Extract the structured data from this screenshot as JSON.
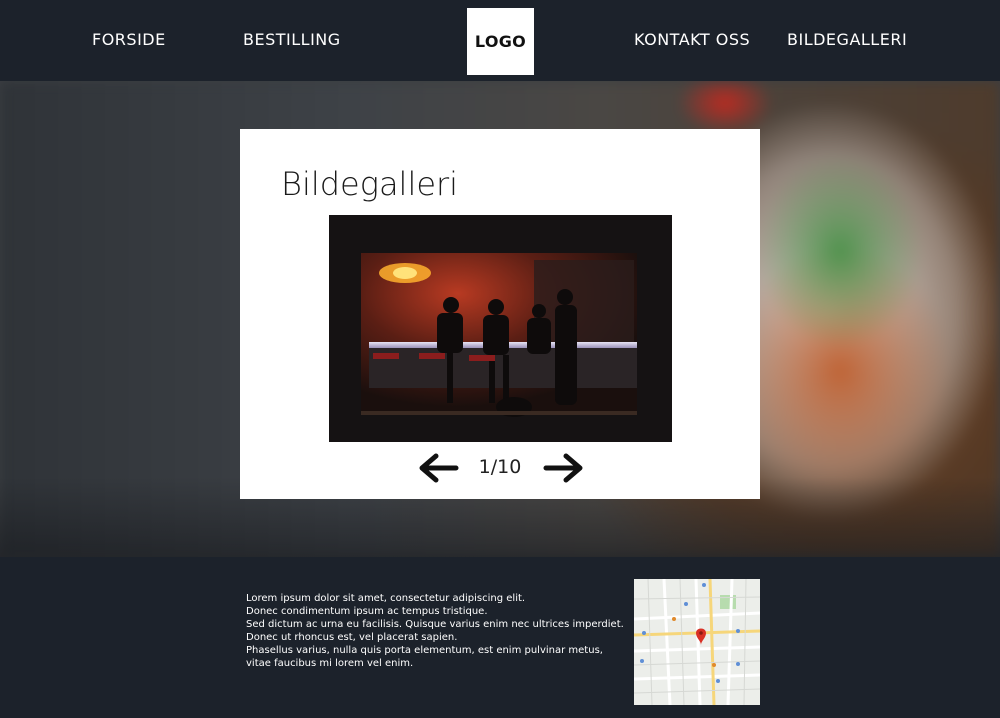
{
  "header": {
    "nav_left": [
      {
        "label": "FORSIDE"
      },
      {
        "label": "BESTILLING"
      }
    ],
    "logo": "LOGO",
    "nav_right": [
      {
        "label": "KONTAKT OSS"
      },
      {
        "label": "BILDEGALLERI"
      }
    ]
  },
  "gallery": {
    "title": "Bildegalleri",
    "counter": "1/10",
    "prev_icon": "arrow-left-icon",
    "next_icon": "arrow-right-icon"
  },
  "footer": {
    "lines": [
      "Lorem ipsum dolor sit amet, consectetur adipiscing elit.",
      "Donec condimentum ipsum ac tempus tristique.",
      "Sed dictum ac urna eu facilisis. Quisque varius enim nec ultrices imperdiet.",
      "Donec ut rhoncus est, vel placerat sapien.",
      "Phasellus varius, nulla quis porta elementum, est enim pulvinar metus,",
      "vitae faucibus mi lorem vel enim."
    ]
  },
  "colors": {
    "header_bg": "#1c222b",
    "card_bg": "#ffffff",
    "text_light": "#ffffff",
    "map_pin": "#d93025"
  }
}
